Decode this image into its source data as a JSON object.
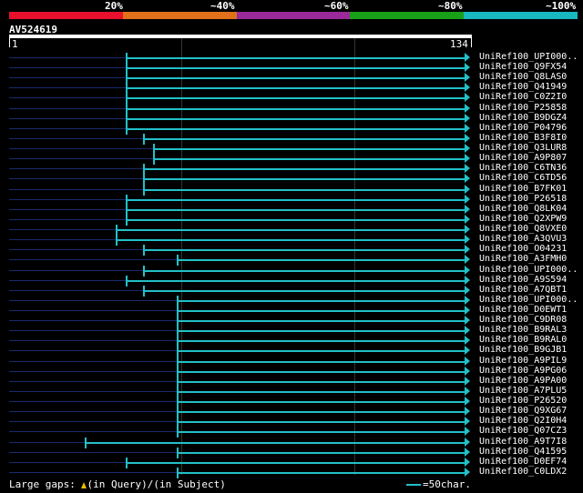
{
  "legend": {
    "labels": [
      "20%",
      "~40%",
      "~60%",
      "~80%",
      "~100%"
    ],
    "colors": [
      "#e8102c",
      "#e0701a",
      "#9a2a9a",
      "#18a018",
      "#18b8c0"
    ]
  },
  "query": {
    "id": "AV524619",
    "start": "1",
    "end": "134"
  },
  "hits": [
    {
      "label": "UniRef100_UPI000..",
      "start": 35,
      "end": 134
    },
    {
      "label": "UniRef100_Q9FX54",
      "start": 35,
      "end": 134
    },
    {
      "label": "UniRef100_Q8LAS0",
      "start": 35,
      "end": 134
    },
    {
      "label": "UniRef100_Q41949",
      "start": 35,
      "end": 134
    },
    {
      "label": "UniRef100_C0Z2I0",
      "start": 35,
      "end": 134
    },
    {
      "label": "UniRef100_P25858",
      "start": 35,
      "end": 134
    },
    {
      "label": "UniRef100_B9DGZ4",
      "start": 35,
      "end": 134
    },
    {
      "label": "UniRef100_P04796",
      "start": 35,
      "end": 134
    },
    {
      "label": "UniRef100_B3F8I0",
      "start": 40,
      "end": 134
    },
    {
      "label": "UniRef100_Q3LUR8",
      "start": 43,
      "end": 134
    },
    {
      "label": "UniRef100_A9P807",
      "start": 43,
      "end": 134
    },
    {
      "label": "UniRef100_C6TN36",
      "start": 40,
      "end": 134
    },
    {
      "label": "UniRef100_C6TD56",
      "start": 40,
      "end": 134
    },
    {
      "label": "UniRef100_B7FK01",
      "start": 40,
      "end": 134
    },
    {
      "label": "UniRef100_P26518",
      "start": 35,
      "end": 134
    },
    {
      "label": "UniRef100_Q8LK04",
      "start": 35,
      "end": 134
    },
    {
      "label": "UniRef100_Q2XPW9",
      "start": 35,
      "end": 134
    },
    {
      "label": "UniRef100_Q8VXE0",
      "start": 32,
      "end": 134
    },
    {
      "label": "UniRef100_A3QVU3",
      "start": 32,
      "end": 134
    },
    {
      "label": "UniRef100_O04231",
      "start": 40,
      "end": 134
    },
    {
      "label": "UniRef100_A3FMH0",
      "start": 50,
      "end": 134
    },
    {
      "label": "UniRef100_UPI000..",
      "start": 40,
      "end": 134
    },
    {
      "label": "UniRef100_A9S594",
      "start": 35,
      "end": 134
    },
    {
      "label": "UniRef100_A7QBT1",
      "start": 40,
      "end": 134
    },
    {
      "label": "UniRef100_UPI000..",
      "start": 50,
      "end": 134
    },
    {
      "label": "UniRef100_D0EWT1",
      "start": 50,
      "end": 134
    },
    {
      "label": "UniRef100_C9DR08",
      "start": 50,
      "end": 134
    },
    {
      "label": "UniRef100_B9RAL3",
      "start": 50,
      "end": 134
    },
    {
      "label": "UniRef100_B9RAL0",
      "start": 50,
      "end": 134
    },
    {
      "label": "UniRef100_B9GJB1",
      "start": 50,
      "end": 134
    },
    {
      "label": "UniRef100_A9PIL9",
      "start": 50,
      "end": 134
    },
    {
      "label": "UniRef100_A9PG06",
      "start": 50,
      "end": 134
    },
    {
      "label": "UniRef100_A9PA00",
      "start": 50,
      "end": 134
    },
    {
      "label": "UniRef100_A7PLU5",
      "start": 50,
      "end": 134
    },
    {
      "label": "UniRef100_P26520",
      "start": 50,
      "end": 134
    },
    {
      "label": "UniRef100_Q9XG67",
      "start": 50,
      "end": 134
    },
    {
      "label": "UniRef100_Q2I0H4",
      "start": 50,
      "end": 134
    },
    {
      "label": "UniRef100_Q07CZ3",
      "start": 50,
      "end": 134
    },
    {
      "label": "UniRef100_A9T7I8",
      "start": 23,
      "end": 134
    },
    {
      "label": "UniRef100_Q41595",
      "start": 50,
      "end": 134
    },
    {
      "label": "UniRef100_D0EF74",
      "start": 35,
      "end": 134
    },
    {
      "label": "UniRef100_C0LDX2",
      "start": 50,
      "end": 134
    }
  ],
  "footer": {
    "text_a": "Large gaps: ",
    "text_b": "(in Query)/",
    "text_c": "(in Subject)",
    "scale_label": "=50char."
  },
  "colors": {
    "hit_bar": "#22c0c8",
    "gap_line": "#1a2a6a",
    "grid": "#2a3a2a"
  }
}
